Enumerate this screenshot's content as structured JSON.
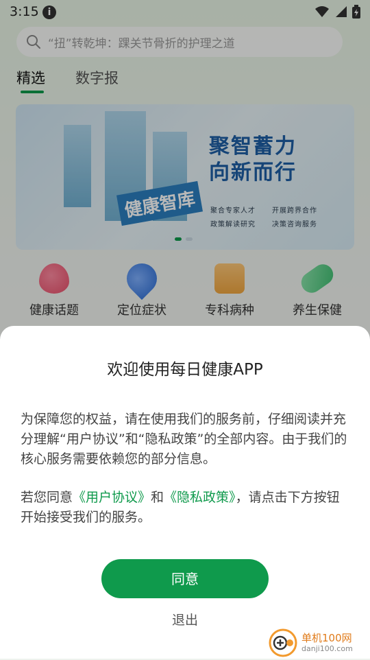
{
  "status_bar": {
    "time": "3:15"
  },
  "search": {
    "placeholder": "“扭”转乾坤：踝关节骨折的护理之道"
  },
  "tabs": [
    {
      "label": "精选",
      "active": true
    },
    {
      "label": "数字报",
      "active": false
    }
  ],
  "banner": {
    "title_line1": "聚智蓄力",
    "title_line2": "向新而行",
    "library": "健康智库",
    "sub1": "聚合专家人才",
    "sub2": "开展跨界合作",
    "sub3": "政策解读研究",
    "sub4": "决策咨询服务",
    "slide_index": 1,
    "slide_count": 2
  },
  "categories": [
    {
      "label": "健康话题",
      "icon": "heart-icon",
      "color": "#e9506b"
    },
    {
      "label": "定位症状",
      "icon": "location-pin-icon",
      "color": "#2f6fd6"
    },
    {
      "label": "专科病种",
      "icon": "medical-box-icon",
      "color": "#f0a640"
    },
    {
      "label": "养生保健",
      "icon": "pill-icon",
      "color": "#3fbf72"
    }
  ],
  "dialog": {
    "title": "欢迎使用每日健康APP",
    "para1": "为保障您的权益，请在使用我们的服务前，仔细阅读并充分理解“用户协议”和“隐私政策”的全部内容。由于我们的核心服务需要依赖您的部分信息。",
    "para2_prefix": "若您同意",
    "user_agreement": "《用户协议》",
    "and": "和",
    "privacy_policy": "《隐私政策》",
    "para2_suffix": "，请点击下方按钮开始接受我们的服务。",
    "agree": "同意",
    "exit": "退出"
  },
  "watermark": {
    "name": "单机100网",
    "url": "danji100.com"
  },
  "colors": {
    "accent": "#0f9a4c"
  }
}
